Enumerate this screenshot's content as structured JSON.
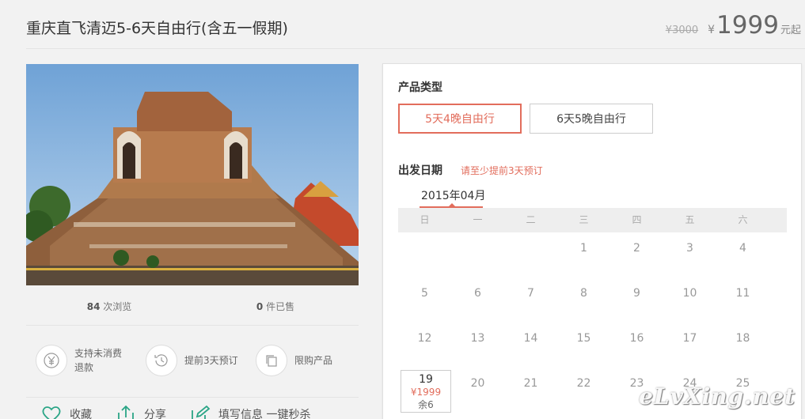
{
  "header": {
    "title": "重庆直飞清迈5-6天自由行(含五一假期)",
    "old_price": "¥3000",
    "currency": "¥",
    "price": "1999",
    "unit": "元起"
  },
  "stats": {
    "views_count": "84",
    "views_label": "次浏览",
    "sold_count": "0",
    "sold_label": "件已售"
  },
  "features": [
    {
      "icon": "yuan-icon",
      "label": "支持未消费退款"
    },
    {
      "icon": "clock-icon",
      "label": "提前3天预订"
    },
    {
      "icon": "copy-icon",
      "label": "限购产品"
    }
  ],
  "actions": {
    "favorite": "收藏",
    "share": "分享",
    "fill_info": "填写信息 一键秒杀"
  },
  "product_type": {
    "label": "产品类型",
    "options": [
      "5天4晚自由行",
      "6天5晚自由行"
    ],
    "selected": 0
  },
  "departure": {
    "label": "出发日期",
    "hint": "请至少提前3天预订",
    "month": "2015年04月",
    "weekdays": [
      "日",
      "一",
      "二",
      "三",
      "四",
      "五",
      "六"
    ],
    "days": [
      "",
      "",
      "",
      "1",
      "2",
      "3",
      "4",
      "5",
      "6",
      "7",
      "8",
      "9",
      "10",
      "11",
      "12",
      "13",
      "14",
      "15",
      "16",
      "17",
      "18",
      "19",
      "20",
      "21",
      "22",
      "23",
      "24",
      "25"
    ],
    "available": {
      "day": "19",
      "price": "¥1999",
      "remaining": "余6"
    }
  },
  "watermark": "eLvXing.net",
  "colors": {
    "accent": "#e26d5c",
    "background": "#f2f2f2"
  }
}
